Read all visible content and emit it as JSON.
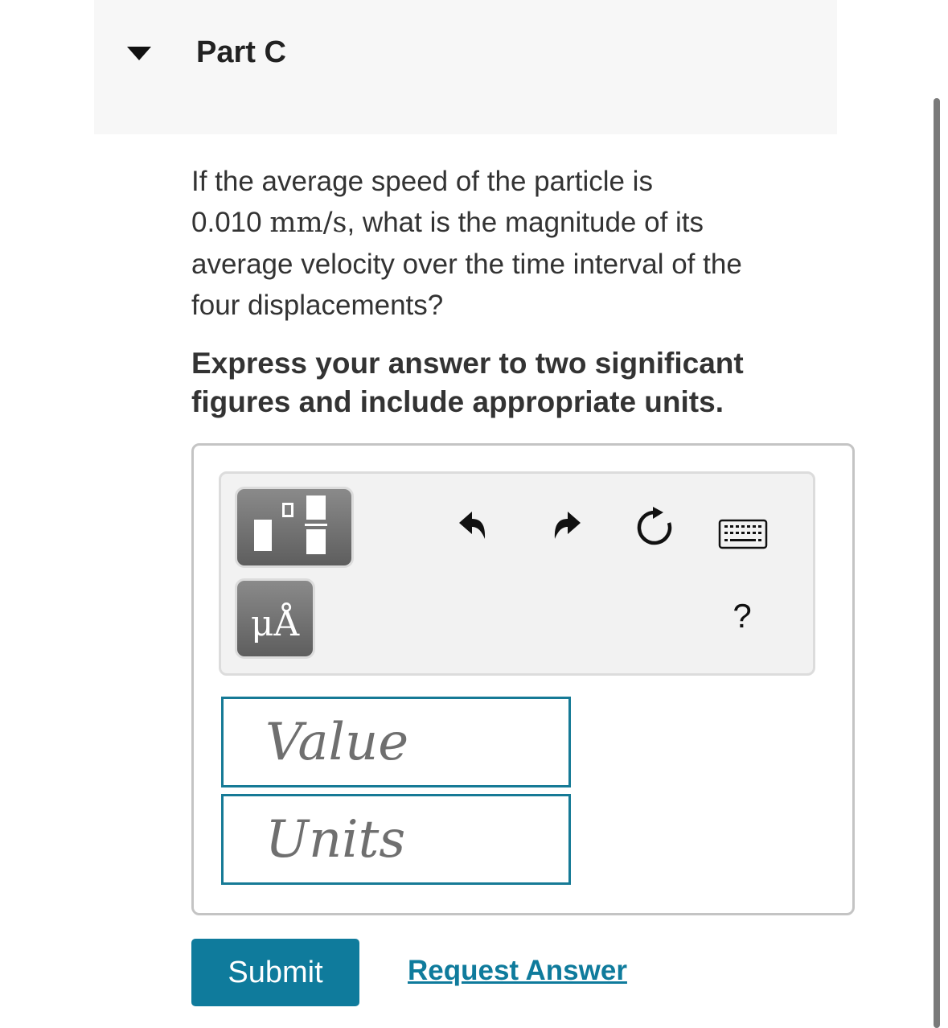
{
  "part": {
    "title": "Part C"
  },
  "question": {
    "line1": "If the average speed of the particle is",
    "speed_value": "0.010",
    "speed_unit": "mm/s",
    "line2_rest": ", what is the magnitude of its",
    "line3": "average velocity over the time interval of the",
    "line4": "four displacements?"
  },
  "instruction": "Express your answer to two significant figures and include appropriate units.",
  "toolbar": {
    "units_label": "μÅ",
    "help_label": "?",
    "icons": [
      "templates-icon",
      "units-icon",
      "undo-icon",
      "redo-icon",
      "reset-icon",
      "keyboard-icon",
      "help-icon"
    ]
  },
  "inputs": {
    "value_placeholder": "Value",
    "units_placeholder": "Units"
  },
  "actions": {
    "submit_label": "Submit",
    "request_answer_label": "Request Answer"
  },
  "colors": {
    "accent": "#0f7b9c",
    "input_border": "#167a96",
    "header_bg": "#f7f7f7"
  }
}
